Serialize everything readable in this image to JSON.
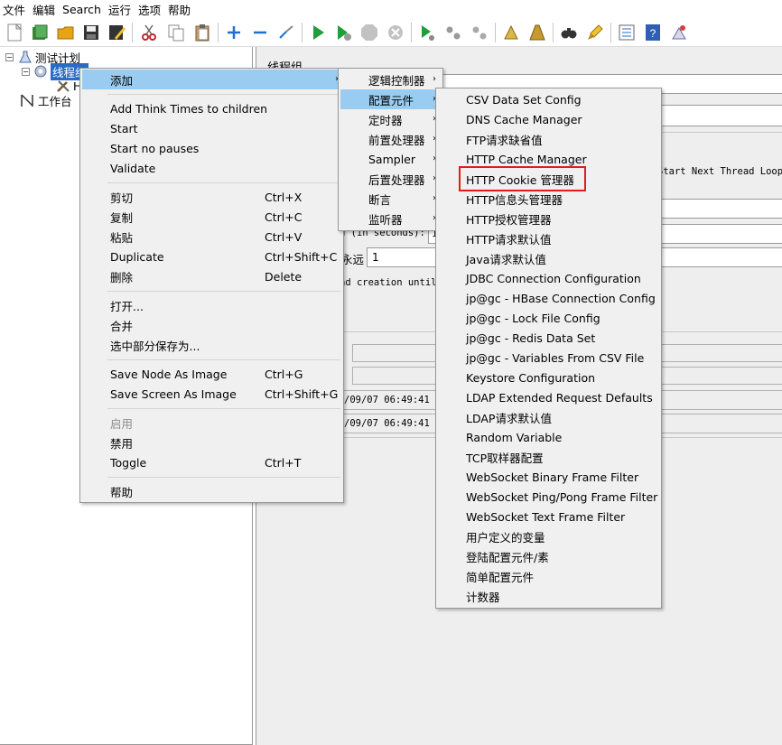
{
  "menubar": [
    "文件",
    "编辑",
    "Search",
    "运行",
    "选项",
    "帮助"
  ],
  "tree": {
    "plan": "测试计划",
    "thread_group": "线程组",
    "child_partial": "H",
    "workbench": "工作台"
  },
  "content": {
    "title": "线程组",
    "next_loop_label": "Start Next Thread Loop",
    "duration_label": "d (in seconds):",
    "duration_value": "1",
    "forever_label": "永远",
    "loop_value": "1",
    "delay_label": "ad creation until",
    "time1": "/09/07 06:49:41",
    "time2": "/09/07 06:49:41"
  },
  "context_menu": {
    "add": "添加",
    "add_think_times": "Add Think Times to children",
    "start": "Start",
    "start_no_pauses": "Start no pauses",
    "validate": "Validate",
    "cut": "剪切",
    "cut_acc": "Ctrl+X",
    "copy": "复制",
    "copy_acc": "Ctrl+C",
    "paste": "粘贴",
    "paste_acc": "Ctrl+V",
    "duplicate": "Duplicate",
    "duplicate_acc": "Ctrl+Shift+C",
    "delete": "删除",
    "delete_acc": "Delete",
    "open": "打开...",
    "merge": "合并",
    "save_selection": "选中部分保存为...",
    "save_node_image": "Save Node As Image",
    "save_node_acc": "Ctrl+G",
    "save_screen_image": "Save Screen As Image",
    "save_screen_acc": "Ctrl+Shift+G",
    "enable": "启用",
    "disable": "禁用",
    "toggle": "Toggle",
    "toggle_acc": "Ctrl+T",
    "help": "帮助"
  },
  "add_submenu": [
    "逻辑控制器",
    "配置元件",
    "定时器",
    "前置处理器",
    "Sampler",
    "后置处理器",
    "断言",
    "监听器"
  ],
  "config_submenu": [
    "CSV Data Set Config",
    "DNS Cache Manager",
    "FTP请求缺省值",
    "HTTP Cache Manager",
    "HTTP Cookie 管理器",
    "HTTP信息头管理器",
    "HTTP授权管理器",
    "HTTP请求默认值",
    "Java请求默认值",
    "JDBC Connection Configuration",
    "jp@gc - HBase Connection Config",
    "jp@gc - Lock File Config",
    "jp@gc - Redis Data Set",
    "jp@gc - Variables From CSV File",
    "Keystore Configuration",
    "LDAP Extended Request Defaults",
    "LDAP请求默认值",
    "Random Variable",
    "TCP取样器配置",
    "WebSocket Binary Frame Filter",
    "WebSocket Ping/Pong Frame Filter",
    "WebSocket Text Frame Filter",
    "用户定义的变量",
    "登陆配置元件/素",
    "简单配置元件",
    "计数器"
  ],
  "colors": {
    "highlight": "#99ccf0",
    "selection": "#2a6cc4",
    "annotation": "#e51a1a"
  }
}
